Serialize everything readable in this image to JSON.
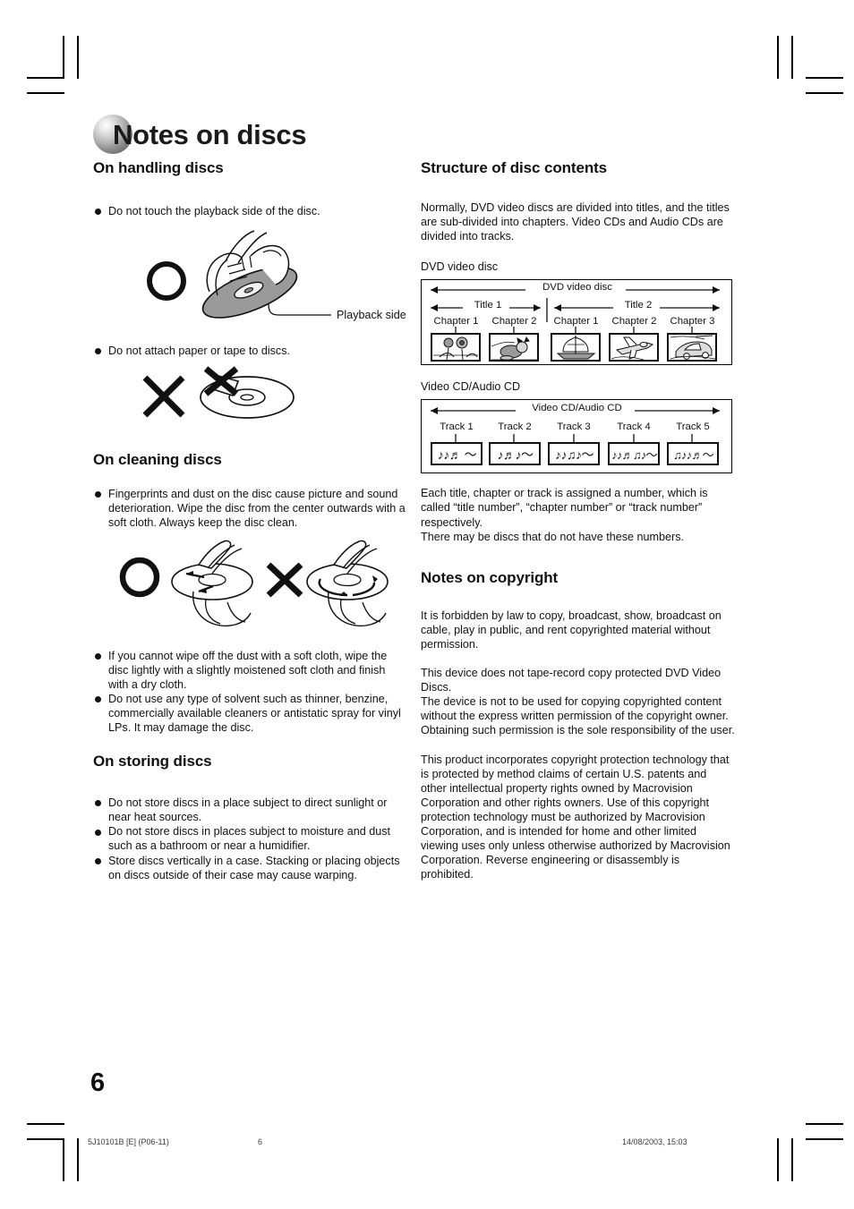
{
  "document": {
    "title": "Notes on discs",
    "page_number": "6"
  },
  "left_column": {
    "handling": {
      "heading": "On handling discs",
      "bullets": [
        "Do not touch the playback side of the disc.",
        "Do not attach paper or tape to discs."
      ],
      "figure_label": "Playback side",
      "ok_mark": "O",
      "no_mark": "X"
    },
    "cleaning": {
      "heading": "On cleaning discs",
      "bullets_top": [
        "Fingerprints and dust on the disc cause picture and sound deterioration. Wipe the disc from the center outwards with a soft cloth. Always keep the disc clean."
      ],
      "bullets_bottom": [
        "If you cannot wipe off the dust with a soft cloth, wipe the disc lightly with a slightly moistened soft cloth and finish with a dry cloth.",
        "Do not use any type of solvent such as thinner, benzine, commercially available cleaners or antistatic spray for vinyl LPs. It may damage the disc."
      ]
    },
    "storing": {
      "heading": "On storing discs",
      "bullets": [
        "Do not store discs in a place subject to direct sunlight or near heat sources.",
        "Do not store discs in places subject to moisture and dust such as a bathroom or near a humidifier.",
        "Store discs vertically in a case. Stacking or placing objects on discs outside of their case may cause warping."
      ]
    }
  },
  "right_column": {
    "structure": {
      "heading": "Structure of disc contents",
      "intro": "Normally, DVD video discs are divided into titles, and the titles are sub-divided into chapters. Video CDs and Audio CDs are divided into tracks.",
      "dvd_caption": "DVD video disc",
      "dvd_diagram": {
        "span_label": "DVD video disc",
        "titles": [
          {
            "label": "Title 1",
            "chapters": [
              "Chapter 1",
              "Chapter 2"
            ]
          },
          {
            "label": "Title 2",
            "chapters": [
              "Chapter 1",
              "Chapter 2",
              "Chapter 3"
            ]
          }
        ],
        "thumbnails": [
          "flowers",
          "cat",
          "sailing-ship",
          "airplane",
          "car"
        ]
      },
      "cd_caption": "Video CD/Audio CD",
      "cd_diagram": {
        "span_label": "Video CD/Audio CD",
        "tracks": [
          "Track 1",
          "Track 2",
          "Track 3",
          "Track 4",
          "Track 5"
        ],
        "note_glyphs": [
          "♪♪♬  ～",
          "♪♬♪～",
          "♪♪♫♪～",
          "♪♪♬♫♪～",
          "♫♪♪♬～"
        ]
      },
      "outro_1": "Each title, chapter or track is assigned a number, which is called “title number”, “chapter number” or “track number” respectively.",
      "outro_2": "There may be discs that do not have these numbers."
    },
    "copyright": {
      "heading": "Notes on copyright",
      "paragraphs": [
        "It is forbidden by law to copy, broadcast, show, broadcast on cable, play in public, and rent copyrighted material without permission.",
        "This device does not tape-record copy protected DVD Video Discs.\nThe device is not to be used for copying copyrighted content without the express written permission of the copyright owner.\nObtaining such permission is the sole responsibility of the user.",
        "This product incorporates copyright protection technology that is protected by method claims of certain U.S. patents and other intellectual property rights owned by Macrovision Corporation and other rights owners. Use of this copyright protection technology must be authorized by Macrovision Corporation, and is intended for home and other limited viewing uses only unless otherwise authorized by Macrovision Corporation. Reverse engineering or disassembly is prohibited."
      ]
    }
  },
  "footer": {
    "file_code": "5J10101B [E] (P06-11)",
    "page": "6",
    "timestamp": "14/08/2003, 15:03"
  }
}
